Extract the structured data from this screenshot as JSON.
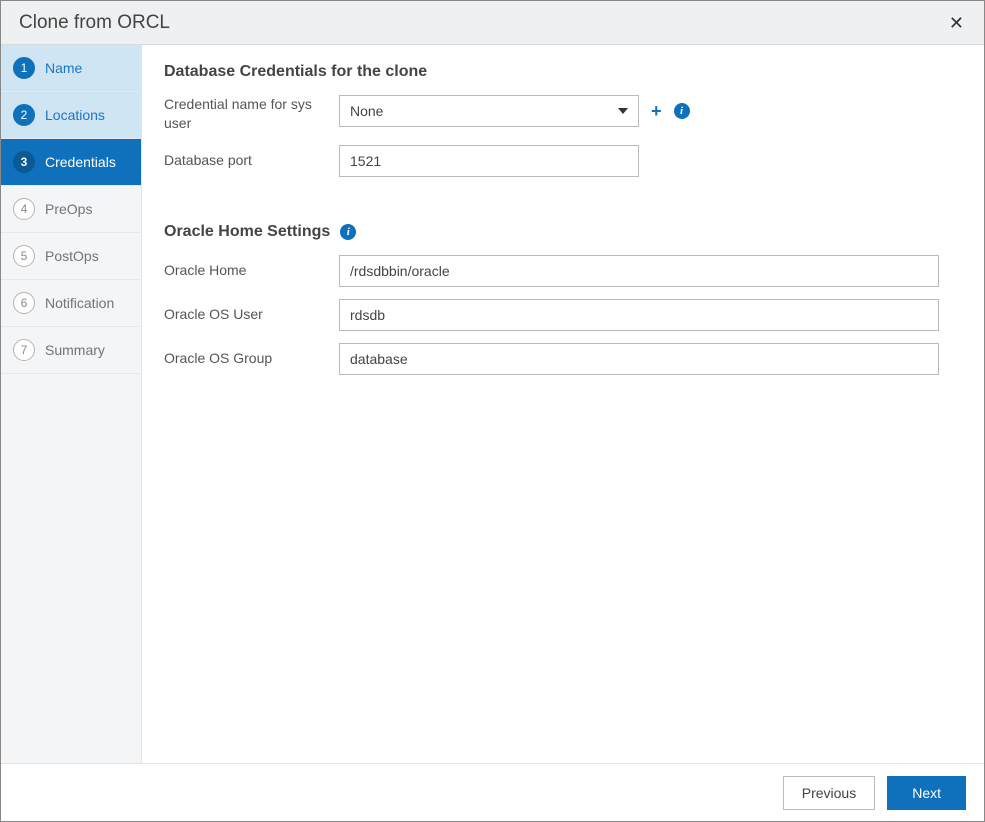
{
  "dialog": {
    "title": "Clone from ORCL"
  },
  "sidebar": {
    "steps": [
      {
        "num": "1",
        "label": "Name",
        "state": "completed"
      },
      {
        "num": "2",
        "label": "Locations",
        "state": "completed"
      },
      {
        "num": "3",
        "label": "Credentials",
        "state": "active"
      },
      {
        "num": "4",
        "label": "PreOps",
        "state": "pending"
      },
      {
        "num": "5",
        "label": "PostOps",
        "state": "pending"
      },
      {
        "num": "6",
        "label": "Notification",
        "state": "pending"
      },
      {
        "num": "7",
        "label": "Summary",
        "state": "pending"
      }
    ]
  },
  "section1": {
    "heading": "Database Credentials for the clone",
    "cred_label": "Credential name for sys user",
    "cred_value": "None",
    "port_label": "Database port",
    "port_value": "1521"
  },
  "section2": {
    "heading": "Oracle Home Settings",
    "home_label": "Oracle Home",
    "home_value": "/rdsdbbin/oracle",
    "osuser_label": "Oracle OS User",
    "osuser_value": "rdsdb",
    "osgroup_label": "Oracle OS Group",
    "osgroup_value": "database"
  },
  "footer": {
    "previous": "Previous",
    "next": "Next"
  }
}
